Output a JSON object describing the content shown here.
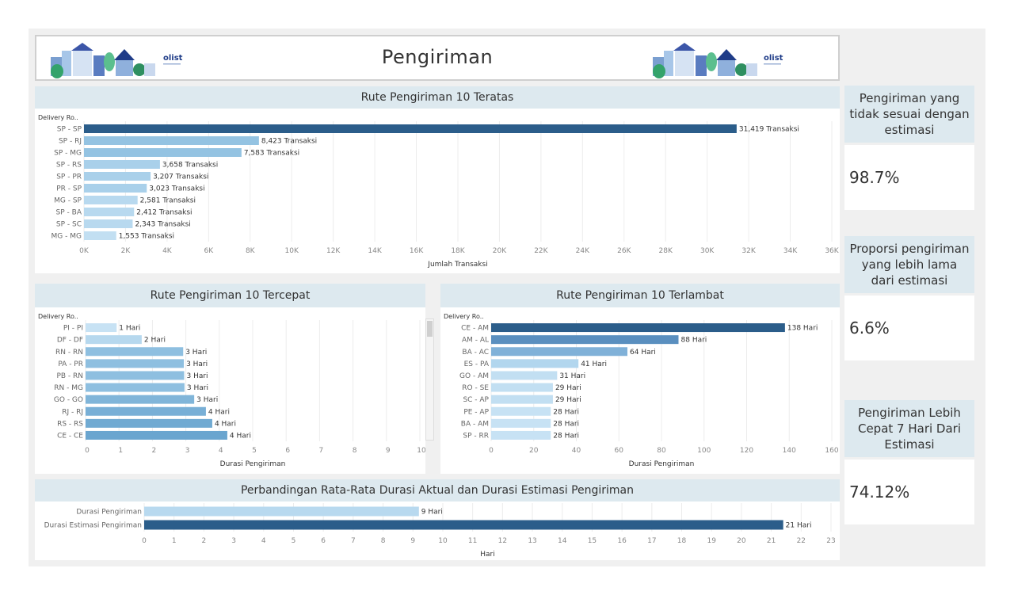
{
  "header": {
    "title": "Pengiriman",
    "logo_text": "olist"
  },
  "charts": {
    "top": {
      "title": "Rute Pengiriman 10 Teratas"
    },
    "fast": {
      "title": "Rute Pengiriman  10 Tercepat"
    },
    "slow": {
      "title": "Rute Pengiriman  10 Terlambat"
    },
    "compare": {
      "title": "Perbandingan Rata-Rata Durasi Aktual dan Durasi Estimasi Pengiriman"
    }
  },
  "kpis": [
    {
      "title": "Pengiriman yang tidak sesuai dengan estimasi",
      "value": "98.7%"
    },
    {
      "title": "Proporsi pengiriman yang lebih lama dari estimasi",
      "value": "6.6%"
    },
    {
      "title": "Pengiriman Lebih Cepat 7 Hari Dari Estimasi",
      "value": "74.12%"
    }
  ],
  "chart_data": [
    {
      "type": "bar",
      "orientation": "horizontal",
      "title": "Rute Pengiriman 10 Teratas",
      "column_header": "Delivery Ro..",
      "xlabel": "Jumlah Transaksi",
      "categories": [
        "SP - SP",
        "SP - RJ",
        "SP - MG",
        "SP - RS",
        "SP - PR",
        "PR - SP",
        "MG - SP",
        "SP - BA",
        "SP - SC",
        "MG - MG"
      ],
      "values": [
        31419,
        8423,
        7583,
        3658,
        3207,
        3023,
        2581,
        2412,
        2343,
        1553
      ],
      "data_labels": [
        "31,419 Transaksi",
        "8,423 Transaksi",
        "7,583 Transaksi",
        "3,658 Transaksi",
        "3,207 Transaksi",
        "3,023 Transaksi",
        "2,581 Transaksi",
        "2,412 Transaksi",
        "2,343 Transaksi",
        "1,553 Transaksi"
      ],
      "colors": [
        "#2b5d8a",
        "#94c3e2",
        "#94c3e2",
        "#a9d0ea",
        "#a9d0ea",
        "#a9d0ea",
        "#b8d9ef",
        "#b8d9ef",
        "#b8d9ef",
        "#c2dff2"
      ],
      "xlim": [
        0,
        36000
      ],
      "ticks": [
        0,
        2000,
        4000,
        6000,
        8000,
        10000,
        12000,
        14000,
        16000,
        18000,
        20000,
        22000,
        24000,
        26000,
        28000,
        30000,
        32000,
        34000,
        36000
      ],
      "tick_labels": [
        "0K",
        "2K",
        "4K",
        "6K",
        "8K",
        "10K",
        "12K",
        "14K",
        "16K",
        "18K",
        "20K",
        "22K",
        "24K",
        "26K",
        "28K",
        "30K",
        "32K",
        "34K",
        "36K"
      ]
    },
    {
      "type": "bar",
      "orientation": "horizontal",
      "title": "Rute Pengiriman  10 Tercepat",
      "column_header": "Delivery Ro..",
      "xlabel": "Durasi Pengiriman",
      "categories": [
        "PI - PI",
        "DF - DF",
        "RN - RN",
        "PA - PR",
        "PB - RN",
        "RN - MG",
        "GO - GO",
        "RJ - RJ",
        "RS - RS",
        "CE - CE"
      ],
      "values": [
        1,
        2,
        3,
        3,
        3,
        3,
        3,
        4,
        4,
        4
      ],
      "data_labels": [
        "1 Hari",
        "2 Hari",
        "3 Hari",
        "3 Hari",
        "3 Hari",
        "3 Hari",
        "3 Hari",
        "4 Hari",
        "4 Hari",
        "4 Hari"
      ],
      "bar_lengths": [
        0.93,
        1.68,
        2.92,
        2.94,
        2.95,
        2.96,
        3.25,
        3.6,
        3.79,
        4.24
      ],
      "colors": [
        "#c7e2f4",
        "#b6d8ee",
        "#8ebfe0",
        "#8ebfe0",
        "#8ebfe0",
        "#8ebfe0",
        "#80b5d9",
        "#78afd6",
        "#70aad2",
        "#6aa5cf"
      ],
      "xlim": [
        0,
        10
      ],
      "ticks": [
        0,
        1,
        2,
        3,
        4,
        5,
        6,
        7,
        8,
        9,
        10
      ],
      "tick_labels": [
        "0",
        "1",
        "2",
        "3",
        "4",
        "5",
        "6",
        "7",
        "8",
        "9",
        "10"
      ]
    },
    {
      "type": "bar",
      "orientation": "horizontal",
      "title": "Rute Pengiriman  10 Terlambat",
      "column_header": "Delivery Ro..",
      "xlabel": "Durasi Pengiriman",
      "categories": [
        "CE - AM",
        "AM - AL",
        "BA - AC",
        "ES - PA",
        "GO - AM",
        "RO - SE",
        "SC - AP",
        "PE - AP",
        "BA - AM",
        "SP - RR"
      ],
      "values": [
        138,
        88,
        64,
        41,
        31,
        29,
        29,
        28,
        28,
        28
      ],
      "data_labels": [
        "138 Hari",
        "88 Hari",
        "64 Hari",
        "41 Hari",
        "31 Hari",
        "29 Hari",
        "29 Hari",
        "28 Hari",
        "28 Hari",
        "28 Hari"
      ],
      "colors": [
        "#2b5d8a",
        "#5a8fbf",
        "#80b1d8",
        "#b2d6ee",
        "#c2dff2",
        "#c2dff2",
        "#c2dff2",
        "#c7e2f4",
        "#c7e2f4",
        "#c7e2f4"
      ],
      "xlim": [
        0,
        160
      ],
      "ticks": [
        0,
        20,
        40,
        60,
        80,
        100,
        120,
        140,
        160
      ],
      "tick_labels": [
        "0",
        "20",
        "40",
        "60",
        "80",
        "100",
        "120",
        "140",
        "160"
      ]
    },
    {
      "type": "bar",
      "orientation": "horizontal",
      "title": "Perbandingan Rata-Rata Durasi Aktual dan Durasi Estimasi Pengiriman",
      "xlabel": "Hari",
      "categories": [
        "Durasi Pengiriman",
        "Durasi Estimasi Pengiriman"
      ],
      "values": [
        9,
        21
      ],
      "data_labels": [
        "9 Hari",
        "21 Hari"
      ],
      "bar_lengths": [
        9.2,
        21.4
      ],
      "colors": [
        "#b8d9ef",
        "#2b5d8a"
      ],
      "xlim": [
        0,
        23
      ],
      "ticks": [
        0,
        1,
        2,
        3,
        4,
        5,
        6,
        7,
        8,
        9,
        10,
        11,
        12,
        13,
        14,
        15,
        16,
        17,
        18,
        19,
        20,
        21,
        22,
        23
      ],
      "tick_labels": [
        "0",
        "1",
        "2",
        "3",
        "4",
        "5",
        "6",
        "7",
        "8",
        "9",
        "10",
        "11",
        "12",
        "13",
        "14",
        "15",
        "16",
        "17",
        "18",
        "19",
        "20",
        "21",
        "22",
        "23"
      ]
    }
  ]
}
